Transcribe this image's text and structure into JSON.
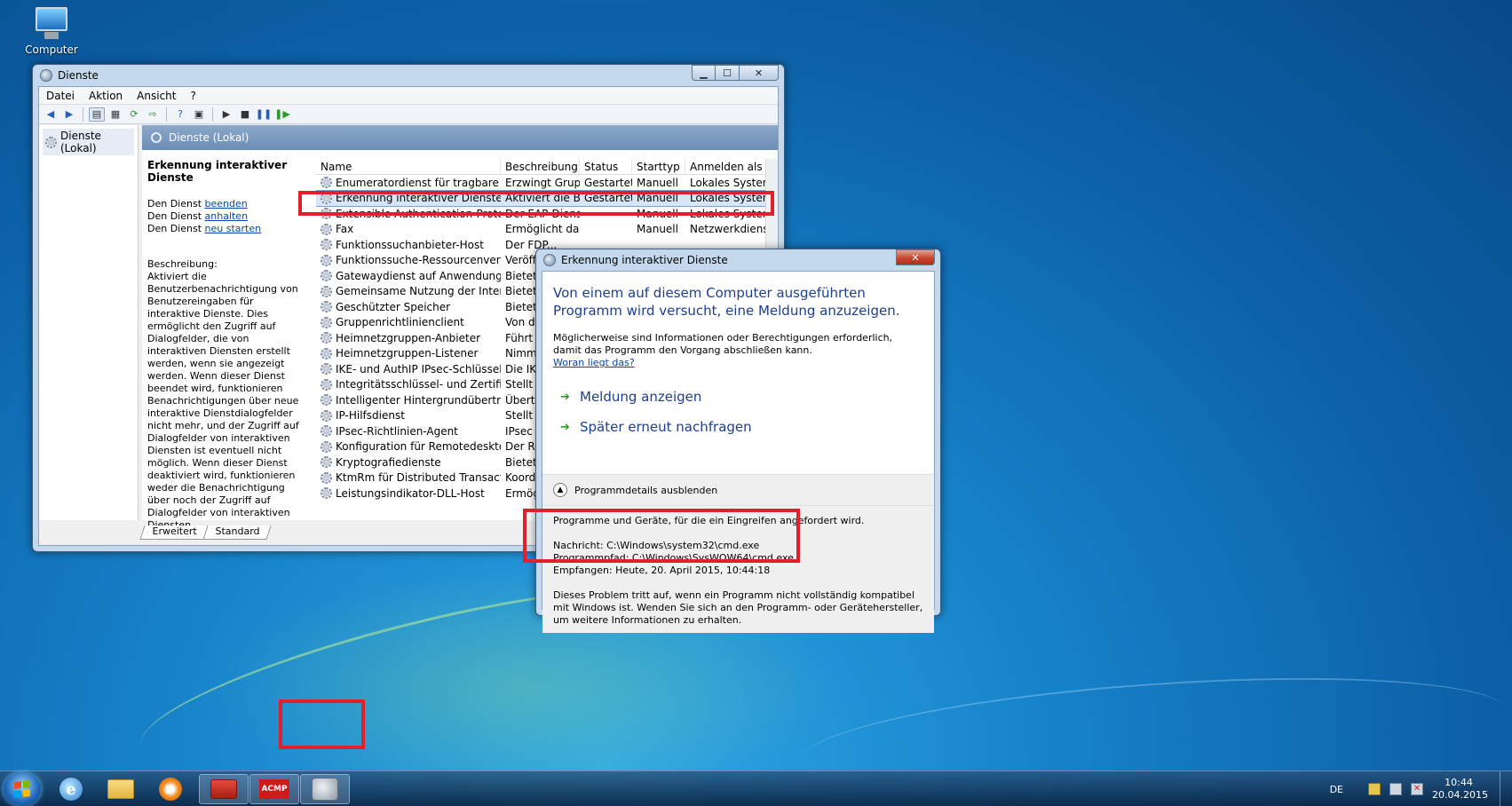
{
  "desktop": {
    "computer_label": "Computer"
  },
  "services_window": {
    "title": "Dienste",
    "menu": [
      "Datei",
      "Aktion",
      "Ansicht",
      "?"
    ],
    "tree_item": "Dienste (Lokal)",
    "pane_header": "Dienste (Lokal)",
    "selected_service": {
      "title": "Erkennung interaktiver Dienste",
      "action_prefix": "Den Dienst",
      "action_stop": "beenden",
      "action_pause": "anhalten",
      "action_restart": "neu starten",
      "description_label": "Beschreibung:",
      "description": "Aktiviert die Benutzerbenachrichtigung von Benutzereingaben für interaktive Dienste. Dies ermöglicht den Zugriff auf Dialogfelder, die von interaktiven Diensten erstellt werden, wenn sie angezeigt werden. Wenn dieser Dienst beendet wird, funktionieren Benachrichtigungen über neue interaktive Dienstdialogfelder nicht mehr, und der Zugriff auf Dialogfelder von interaktiven Diensten ist eventuell nicht möglich. Wenn dieser Dienst deaktiviert wird, funktionieren weder die Benachrichtigung über noch der Zugriff auf Dialogfelder von interaktiven Diensten."
    },
    "columns": [
      "Name",
      "Beschreibung",
      "Status",
      "Starttyp",
      "Anmelden als"
    ],
    "rows": [
      [
        "Enumeratordienst für tragbare Geräte",
        "Erzwingt Grup...",
        "Gestartet",
        "Manuell",
        "Lokales System"
      ],
      [
        "Erkennung interaktiver Dienste",
        "Aktiviert die B...",
        "Gestartet",
        "Manuell",
        "Lokales System"
      ],
      [
        "Extensible Authentication-Protokoll",
        "Der EAP-Diens...",
        "",
        "Manuell",
        "Lokales System"
      ],
      [
        "Fax",
        "Ermöglicht da...",
        "",
        "Manuell",
        "Netzwerkdienst"
      ],
      [
        "Funktionssuchanbieter-Host",
        "Der FDP...",
        "",
        "",
        ""
      ],
      [
        "Funktionssuche-Ressourcenveröffen...",
        "Veröffe...",
        "",
        "",
        ""
      ],
      [
        "Gatewaydienst auf Anwendungsebene",
        "Bietet U...",
        "",
        "",
        ""
      ],
      [
        "Gemeinsame Nutzung der Internetv...",
        "Bietet a...",
        "",
        "",
        ""
      ],
      [
        "Geschützter Speicher",
        "Bietet g...",
        "",
        "",
        ""
      ],
      [
        "Gruppenrichtlinienclient",
        "Von de...",
        "",
        "",
        ""
      ],
      [
        "Heimnetzgruppen-Anbieter",
        "Führt N...",
        "",
        "",
        ""
      ],
      [
        "Heimnetzgruppen-Listener",
        "Nimmt...",
        "",
        "",
        ""
      ],
      [
        "IKE- und AuthIP IPsec-Schlüsselerste...",
        "Die IKE...",
        "",
        "",
        ""
      ],
      [
        "Integritätsschlüssel- und Zertifikatve...",
        "Stellt ei...",
        "",
        "",
        ""
      ],
      [
        "Intelligenter Hintergrundübertragun...",
        "Übertrà...",
        "",
        "",
        ""
      ],
      [
        "IP-Hilfsdienst",
        "Stellt T...",
        "",
        "",
        ""
      ],
      [
        "IPsec-Richtlinien-Agent",
        "IPsec (I...",
        "",
        "",
        ""
      ],
      [
        "Konfiguration für Remotedesktops",
        "Der Rem...",
        "",
        "",
        ""
      ],
      [
        "Kryptografiedienste",
        "Bietet v...",
        "",
        "",
        ""
      ],
      [
        "KtmRm für Distributed Transaction ...",
        "Koordin...",
        "",
        "",
        ""
      ],
      [
        "Leistungsindikator-DLL-Host",
        "Ermögli...",
        "",
        "",
        ""
      ]
    ],
    "tabs": [
      "Erweitert",
      "Standard"
    ]
  },
  "dialog": {
    "title": "Erkennung interaktiver Dienste",
    "heading": "Von einem auf diesem Computer ausgeführten Programm wird versucht, eine Meldung anzuzeigen.",
    "text": "Möglicherweise sind Informationen oder Berechtigungen erforderlich, damit das Programm den Vorgang abschließen kann.",
    "link": "Woran liegt das?",
    "option1": "Meldung anzeigen",
    "option2": "Später erneut nachfragen",
    "toggle": "Programmdetails ausblenden",
    "details_intro": "Programme und Geräte, für die ein Eingreifen angefordert wird.",
    "message_line": "Nachricht:  C:\\Windows\\system32\\cmd.exe",
    "path_line": "Programmpfad:  C:\\Windows\\SysWOW64\\cmd.exe",
    "received_line": "Empfangen:  Heute, 20. April 2015, 10:44:18",
    "footer": "Dieses Problem tritt auf, wenn ein Programm nicht vollständig kompatibel mit Windows ist. Wenden Sie sich an den Programm- oder Gerätehersteller, um weitere Informationen zu erhalten."
  },
  "taskbar": {
    "acmp_label": "ACMP",
    "language": "DE",
    "time": "10:44",
    "date": "20.04.2015"
  }
}
